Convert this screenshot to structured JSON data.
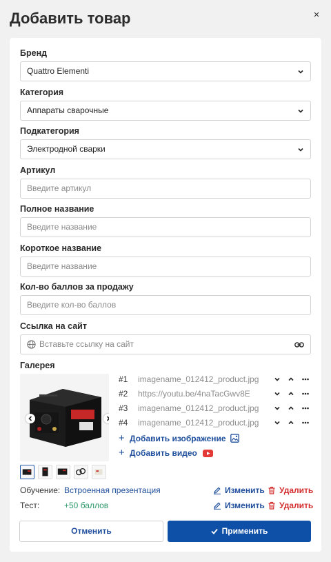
{
  "title": "Добавить товар",
  "close_label": "×",
  "fields": {
    "brand": {
      "label": "Бренд",
      "value": "Quattro Elementi"
    },
    "category": {
      "label": "Категория",
      "value": "Аппараты сварочные"
    },
    "subcategory": {
      "label": "Подкатегория",
      "value": "Электродной сварки"
    },
    "article": {
      "label": "Артикул",
      "placeholder": "Введите артикул"
    },
    "full_name": {
      "label": "Полное название",
      "placeholder": "Введите название"
    },
    "short_name": {
      "label": "Короткое название",
      "placeholder": "Введите название"
    },
    "points": {
      "label": "Кол-во баллов за продажу",
      "placeholder": "Введите кол-во баллов"
    },
    "site_link": {
      "label": "Ссылка на сайт",
      "placeholder": "Вставьте ссылку на сайт"
    }
  },
  "gallery": {
    "label": "Галерея",
    "items": [
      {
        "num": "#1",
        "name": "imagename_012412_product.jpg"
      },
      {
        "num": "#2",
        "name": "https://youtu.be/4naTacGwv8E"
      },
      {
        "num": "#3",
        "name": "imagename_012412_product.jpg"
      },
      {
        "num": "#4",
        "name": "imagename_012412_product.jpg"
      }
    ],
    "add_image": "Добавить изображение",
    "add_video": "Добавить видео"
  },
  "training": {
    "label": "Обучение:",
    "value": "Встроенная презентация"
  },
  "test": {
    "label": "Тест:",
    "value": "+50 баллов"
  },
  "actions": {
    "edit": "Изменить",
    "delete": "Удалить"
  },
  "buttons": {
    "cancel": "Отменить",
    "apply": "Применить"
  },
  "colors": {
    "accent": "#0e4fa8",
    "link": "#1f4f9c",
    "danger": "#d32f2f",
    "success": "#2e9a6a"
  }
}
